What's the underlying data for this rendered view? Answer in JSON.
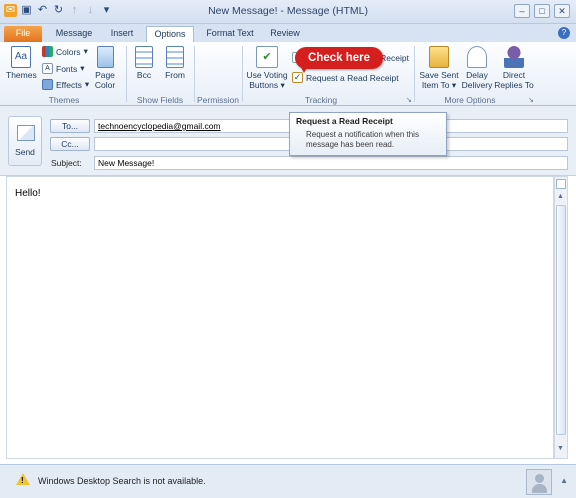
{
  "window": {
    "title": "New Message! - Message (HTML)"
  },
  "tabs": [
    {
      "label": "File"
    },
    {
      "label": "Message"
    },
    {
      "label": "Insert"
    },
    {
      "label": "Options"
    },
    {
      "label": "Format Text"
    },
    {
      "label": "Review"
    }
  ],
  "ribbon": {
    "themes": {
      "themes_label": "Themes",
      "colors_label": "Colors",
      "fonts_label": "Fonts",
      "effects_label": "Effects",
      "page_color_label": "Page Color",
      "group_label": "Themes"
    },
    "show_fields": {
      "bcc_label": "Bcc",
      "from_label": "From",
      "group_label": "Show Fields"
    },
    "permission": {
      "group_label": "Permission"
    },
    "tracking": {
      "voting_label": "Use Voting Buttons",
      "delivery_receipt_label": "Request a Delivery Receipt",
      "read_receipt_label": "Request a Read Receipt",
      "group_label": "Tracking"
    },
    "more_options": {
      "save_sent_label": "Save Sent Item To",
      "delay_delivery_label": "Delay Delivery",
      "direct_replies_label": "Direct Replies To",
      "group_label": "More Options"
    }
  },
  "callout": {
    "text": "Check here"
  },
  "tooltip": {
    "title": "Request a Read Receipt",
    "body": "Request a notification when this message has been read."
  },
  "compose": {
    "send_label": "Send",
    "to_label": "To...",
    "to_value": "technoencyclopedia@gmail.com",
    "cc_label": "Cc...",
    "cc_value": "",
    "subject_label": "Subject:",
    "subject_value": "New Message!",
    "body_text": "Hello!"
  },
  "status": {
    "text": "Windows Desktop Search is not available."
  }
}
